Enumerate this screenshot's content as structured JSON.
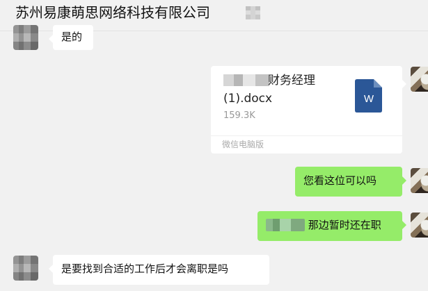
{
  "header": {
    "title": "苏州易康萌思网络科技有限公司"
  },
  "messages": [
    {
      "side": "left",
      "text": "是的"
    },
    {
      "side": "right",
      "type": "file",
      "file_name_line1": "财务经理",
      "file_name_line2": "(1).docx",
      "file_size": "159.3K",
      "source": "微信电脑版",
      "icon_letter": "W",
      "icon": "word-document-icon"
    },
    {
      "side": "right",
      "text": "您看这位可以吗"
    },
    {
      "side": "right",
      "text": "那边暂时还在职"
    },
    {
      "side": "left",
      "text": "是要找到合适的工作后才会离职是吗"
    }
  ],
  "colors": {
    "background": "#f1f1f1",
    "incoming_bubble": "#ffffff",
    "outgoing_bubble": "#95ec69",
    "word_icon": "#2b5797"
  }
}
